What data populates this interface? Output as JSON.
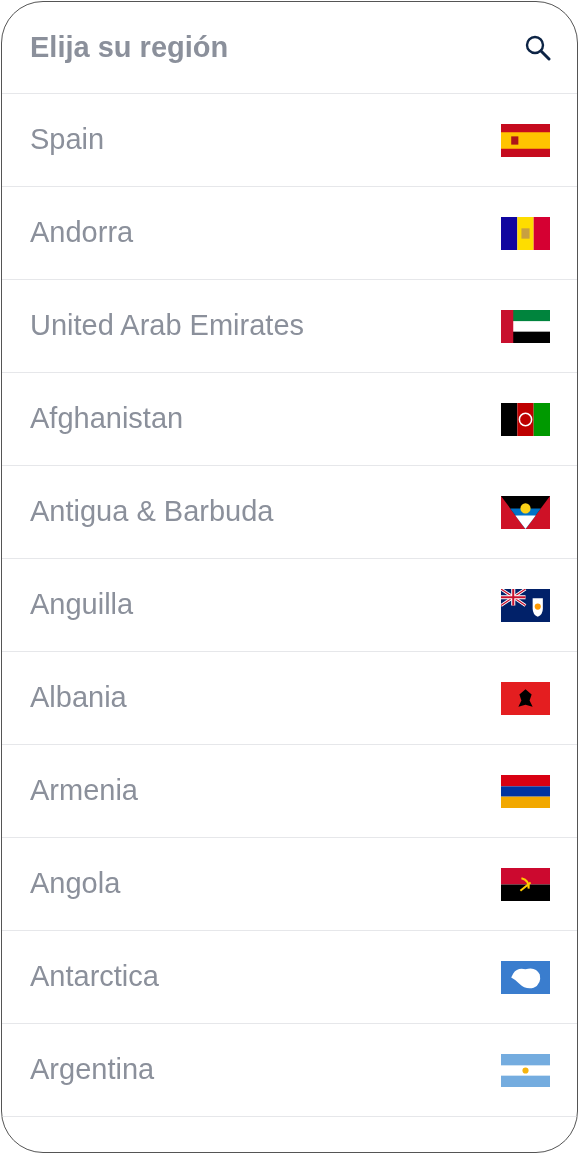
{
  "header": {
    "title": "Elija su región"
  },
  "countries": [
    {
      "name": "Spain"
    },
    {
      "name": "Andorra"
    },
    {
      "name": "United Arab Emirates"
    },
    {
      "name": "Afghanistan"
    },
    {
      "name": "Antigua & Barbuda"
    },
    {
      "name": "Anguilla"
    },
    {
      "name": "Albania"
    },
    {
      "name": "Armenia"
    },
    {
      "name": "Angola"
    },
    {
      "name": "Antarctica"
    },
    {
      "name": "Argentina"
    }
  ]
}
